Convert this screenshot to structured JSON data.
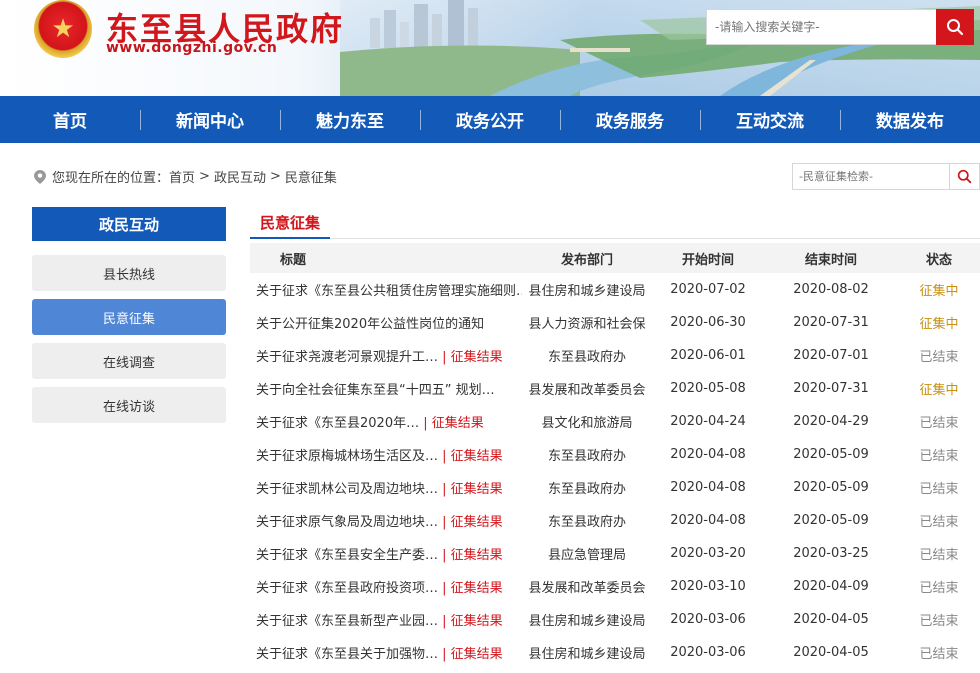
{
  "header": {
    "site_title": "东至县人民政府",
    "site_url": "www.dongzhi.gov.cn",
    "search_placeholder": "-请输入搜索关键字-"
  },
  "nav": [
    "首页",
    "新闻中心",
    "魅力东至",
    "政务公开",
    "政务服务",
    "互动交流",
    "数据发布"
  ],
  "breadcrumb": {
    "prefix": "您现在所在的位置：",
    "items": [
      "首页",
      "政民互动",
      "民意征集"
    ],
    "separator": ">"
  },
  "sub_search_placeholder": "-民意征集检索-",
  "sidebar": {
    "title": "政民互动",
    "items": [
      "县长热线",
      "民意征集",
      "在线调查",
      "在线访谈"
    ],
    "active_index": 1
  },
  "content": {
    "tab": "民意征集",
    "columns": [
      "标题",
      "发布部门",
      "开始时间",
      "结束时间",
      "状态"
    ],
    "result_tag": "| 征集结果",
    "rows": [
      {
        "title": "关于征求《东至县公共租赁住房管理实施细则…",
        "result": false,
        "dept": "县住房和城乡建设局",
        "start": "2020-07-02",
        "end": "2020-08-02",
        "status": "征集中"
      },
      {
        "title": "关于公开征集2020年公益性岗位的通知",
        "result": false,
        "dept": "县人力资源和社会保",
        "start": "2020-06-30",
        "end": "2020-07-31",
        "status": "征集中"
      },
      {
        "title": "关于征求尧渡老河景观提升工…",
        "result": true,
        "dept": "东至县政府办",
        "start": "2020-06-01",
        "end": "2020-07-01",
        "status": "已结束"
      },
      {
        "title": "关于向全社会征集东至县“十四五” 规划…",
        "result": false,
        "dept": "县发展和改革委员会",
        "start": "2020-05-08",
        "end": "2020-07-31",
        "status": "征集中"
      },
      {
        "title": "关于征求《东至县2020年…",
        "result": true,
        "dept": "县文化和旅游局",
        "start": "2020-04-24",
        "end": "2020-04-29",
        "status": "已结束"
      },
      {
        "title": "关于征求原梅城林场生活区及…",
        "result": true,
        "dept": "东至县政府办",
        "start": "2020-04-08",
        "end": "2020-05-09",
        "status": "已结束"
      },
      {
        "title": "关于征求凯林公司及周边地块…",
        "result": true,
        "dept": "东至县政府办",
        "start": "2020-04-08",
        "end": "2020-05-09",
        "status": "已结束"
      },
      {
        "title": "关于征求原气象局及周边地块…",
        "result": true,
        "dept": "东至县政府办",
        "start": "2020-04-08",
        "end": "2020-05-09",
        "status": "已结束"
      },
      {
        "title": "关于征求《东至县安全生产委…",
        "result": true,
        "dept": "县应急管理局",
        "start": "2020-03-20",
        "end": "2020-03-25",
        "status": "已结束"
      },
      {
        "title": "关于征求《东至县政府投资项…",
        "result": true,
        "dept": "县发展和改革委员会",
        "start": "2020-03-10",
        "end": "2020-04-09",
        "status": "已结束"
      },
      {
        "title": "关于征求《东至县新型产业园…",
        "result": true,
        "dept": "县住房和城乡建设局",
        "start": "2020-03-06",
        "end": "2020-04-05",
        "status": "已结束"
      },
      {
        "title": "关于征求《东至县关于加强物…",
        "result": true,
        "dept": "县住房和城乡建设局",
        "start": "2020-03-06",
        "end": "2020-04-05",
        "status": "已结束"
      }
    ]
  },
  "colors": {
    "brand_red": "#d2161c",
    "nav_blue": "#1359b8",
    "sidebar_active": "#4f86d6",
    "status_active": "#c8900f",
    "status_ended": "#888888"
  }
}
